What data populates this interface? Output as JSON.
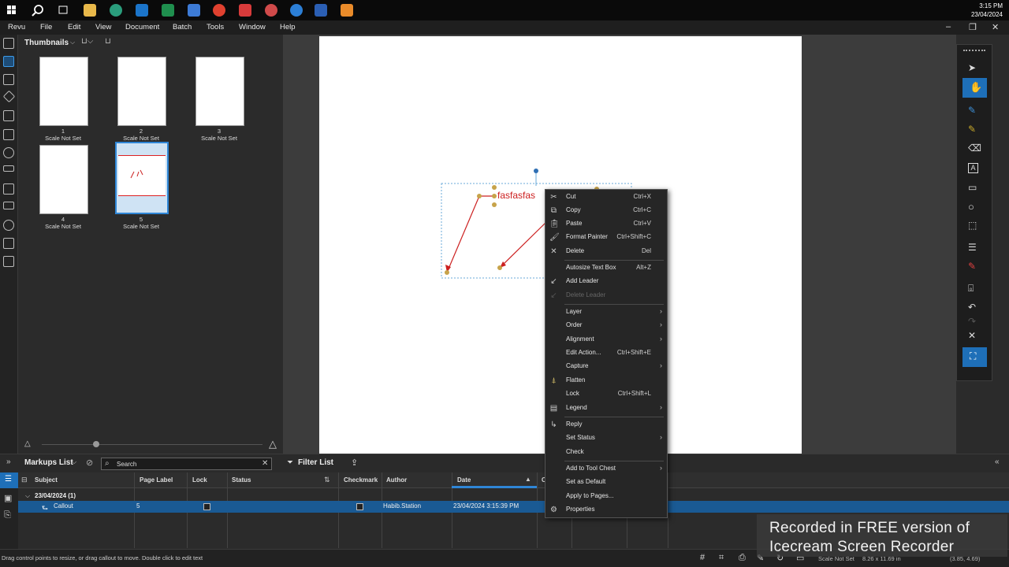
{
  "taskbar": {
    "time": "3:15 PM",
    "date": "23/04/2024"
  },
  "menu": [
    "Revu",
    "File",
    "Edit",
    "View",
    "Document",
    "Batch",
    "Tools",
    "Window",
    "Help"
  ],
  "thumbnails": {
    "title": "Thumbnails",
    "pages": [
      {
        "num": "1",
        "scale": "Scale Not Set"
      },
      {
        "num": "2",
        "scale": "Scale Not Set"
      },
      {
        "num": "3",
        "scale": "Scale Not Set"
      },
      {
        "num": "4",
        "scale": "Scale Not Set"
      },
      {
        "num": "5",
        "scale": "Scale Not Set"
      }
    ]
  },
  "callout": {
    "text": "fasfasfas",
    "color": "#cc2020"
  },
  "context_menu": [
    {
      "label": "Cut",
      "shortcut": "Ctrl+X",
      "icon": "scissors-icon"
    },
    {
      "label": "Copy",
      "shortcut": "Ctrl+C",
      "icon": "copy-icon"
    },
    {
      "label": "Paste",
      "shortcut": "Ctrl+V",
      "icon": "paste-icon"
    },
    {
      "label": "Format Painter",
      "shortcut": "Ctrl+Shift+C",
      "icon": "format-painter-icon"
    },
    {
      "label": "Delete",
      "shortcut": "Del",
      "icon": "close-icon"
    },
    {
      "label": "Autosize Text Box",
      "shortcut": "Alt+Z"
    },
    {
      "label": "Add Leader",
      "icon": "leader-icon"
    },
    {
      "label": "Delete Leader",
      "disabled": true
    },
    {
      "label": "Layer",
      "submenu": true
    },
    {
      "label": "Order",
      "submenu": true
    },
    {
      "label": "Alignment",
      "submenu": true
    },
    {
      "label": "Edit Action...",
      "shortcut": "Ctrl+Shift+E"
    },
    {
      "label": "Capture",
      "submenu": true
    },
    {
      "label": "Flatten",
      "icon": "flatten-icon"
    },
    {
      "label": "Lock",
      "shortcut": "Ctrl+Shift+L"
    },
    {
      "label": "Legend",
      "submenu": true,
      "icon": "legend-icon"
    },
    {
      "label": "Reply",
      "icon": "reply-icon"
    },
    {
      "label": "Set Status",
      "submenu": true
    },
    {
      "label": "Check"
    },
    {
      "label": "Add to Tool Chest",
      "submenu": true
    },
    {
      "label": "Set as Default"
    },
    {
      "label": "Apply to Pages..."
    },
    {
      "label": "Properties",
      "icon": "gear-icon"
    }
  ],
  "markups": {
    "title": "Markups List",
    "search_placeholder": "Search",
    "filter_label": "Filter List",
    "columns": [
      "Subject",
      "Page Label",
      "Lock",
      "Status",
      "Checkmark",
      "Author",
      "Date",
      "C"
    ],
    "group": "23/04/2024 (1)",
    "row": {
      "subject": "Callout",
      "page": "5",
      "author": "Habib.Station",
      "date": "23/04/2024 3:15:39 PM"
    }
  },
  "status": {
    "message": "Drag control points to resize, or drag callout to move. Double click to edit text",
    "scale": "Scale Not Set",
    "size": "8.26 x 11.69 in",
    "coords": "(3.85, 4.69)"
  },
  "watermark": {
    "line1": "Recorded in FREE version of",
    "line2": "Icecream  Screen  Recorder"
  },
  "colors": {
    "accent": "#1a5a94",
    "selected_tool": "#1e6fb8"
  }
}
